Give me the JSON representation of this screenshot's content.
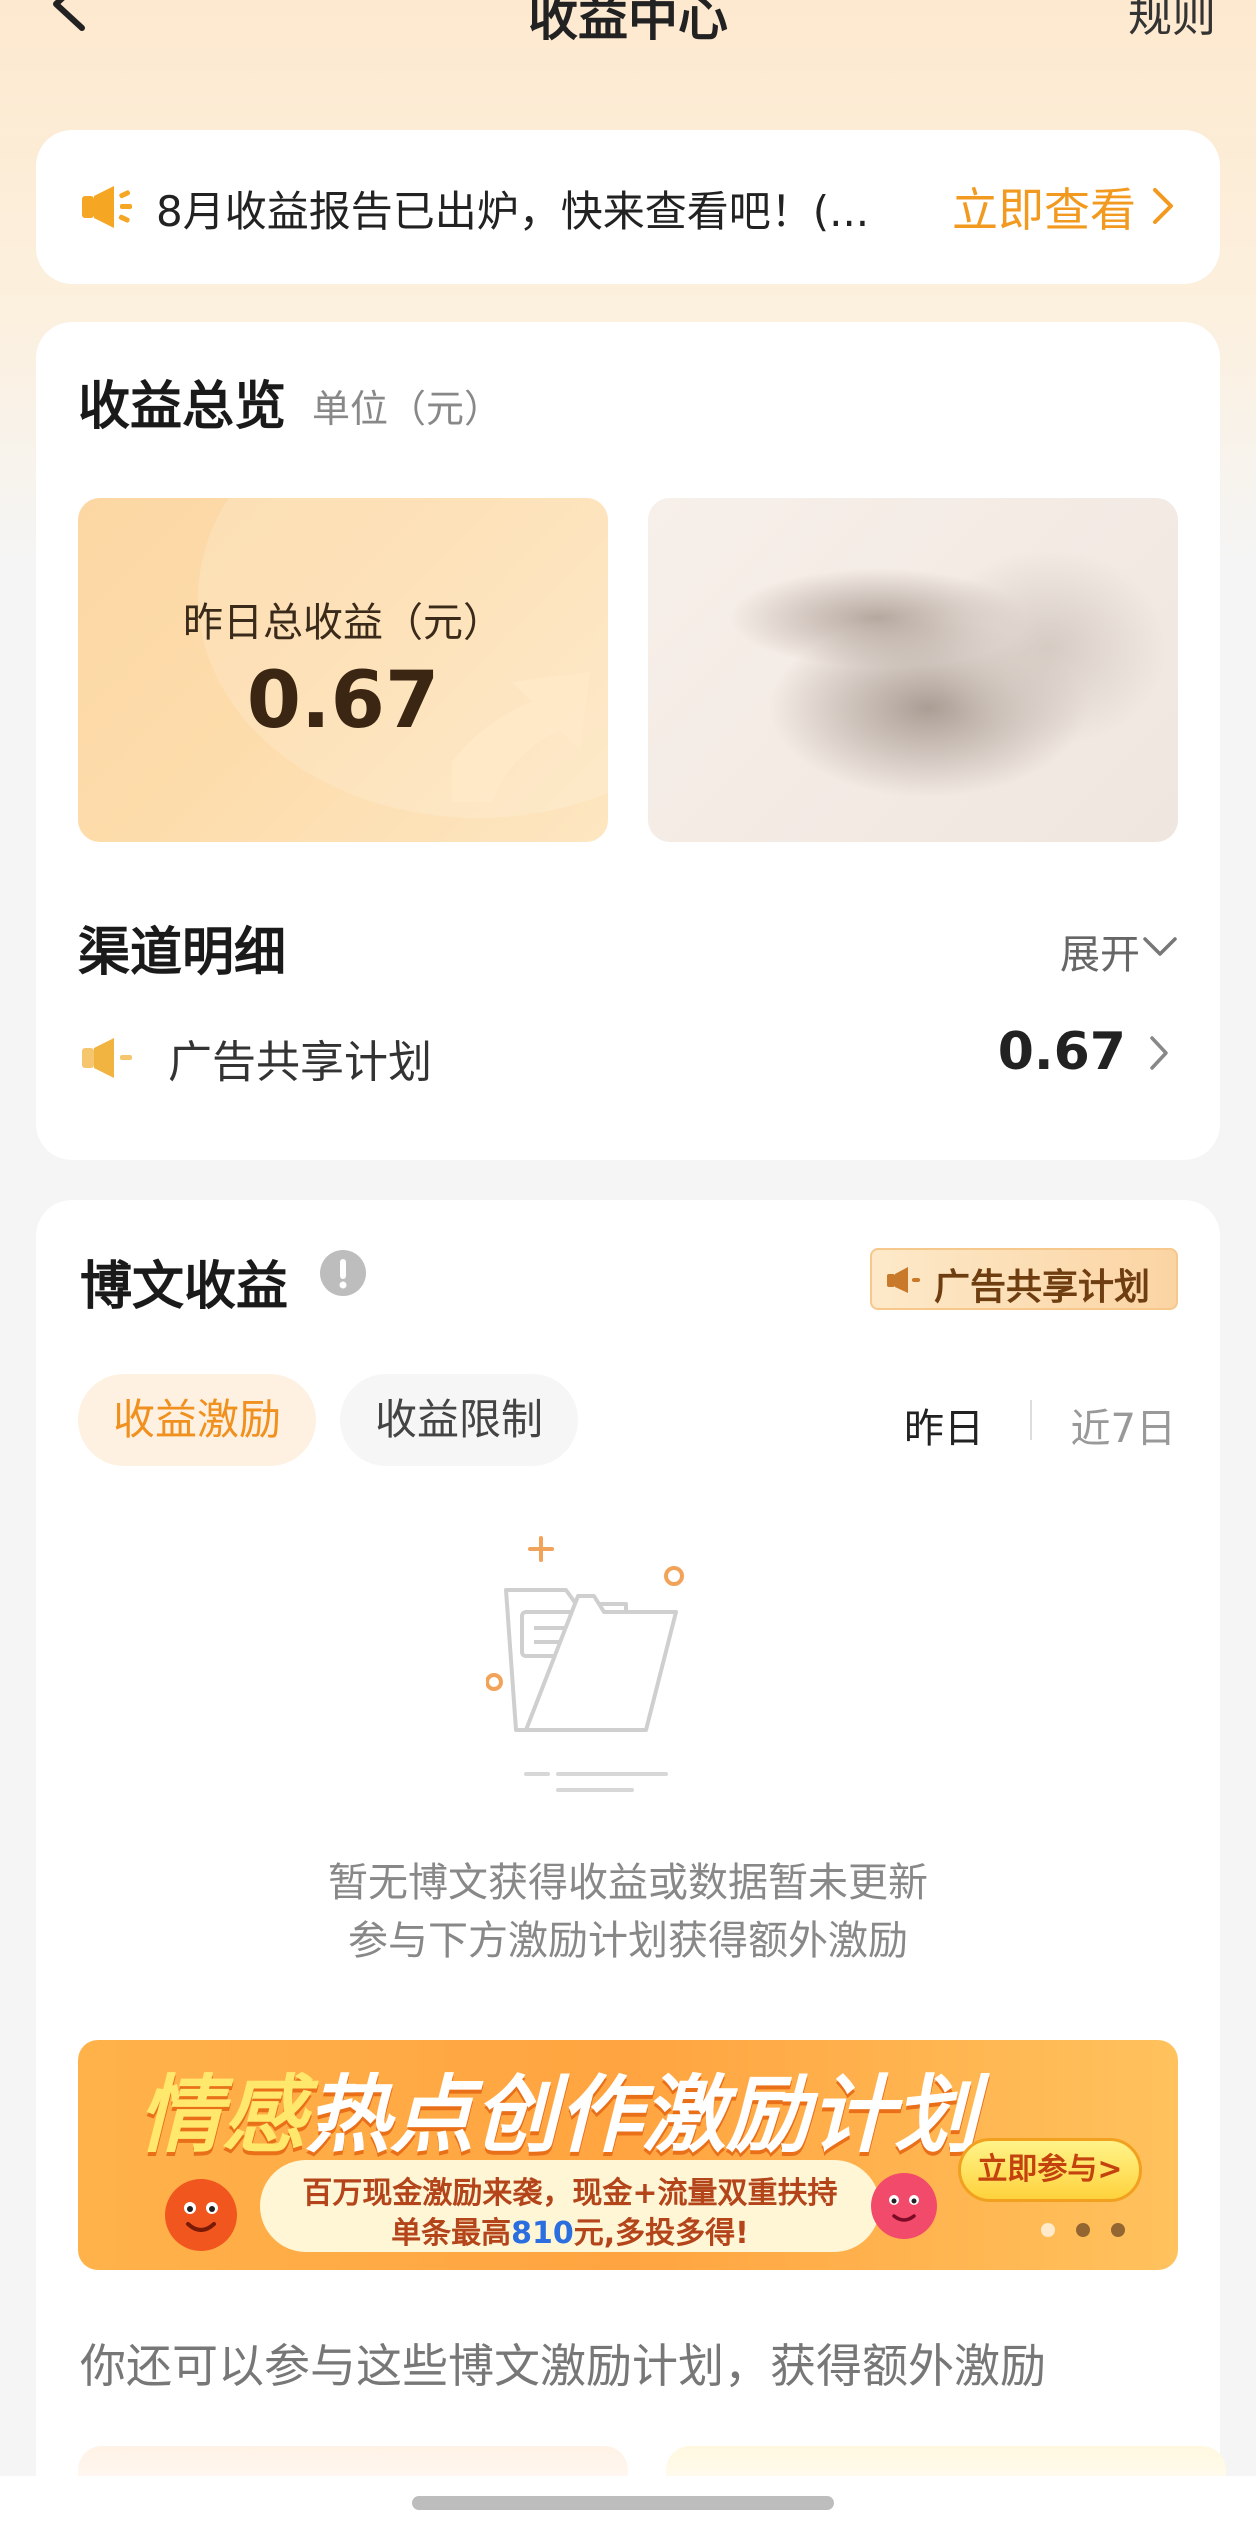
{
  "header": {
    "title": "收益中心",
    "rule_label": "规则"
  },
  "notice": {
    "text": "8月收益报告已出炉，快来查看吧！(...",
    "link_label": "立即查看"
  },
  "overview": {
    "title": "收益总览",
    "unit": "单位（元）",
    "yesterday_label": "昨日总收益（元）",
    "yesterday_value": "0.67"
  },
  "channel": {
    "title": "渠道明细",
    "expand_label": "展开",
    "items": [
      {
        "label": "广告共享计划",
        "value": "0.67"
      }
    ]
  },
  "blog": {
    "title": "博文收益",
    "badge_label": "广告共享计划",
    "tabs": [
      {
        "label": "收益激励",
        "active": true
      },
      {
        "label": "收益限制",
        "active": false
      }
    ],
    "ranges": [
      {
        "label": "昨日",
        "active": true
      },
      {
        "label": "近7日",
        "active": false
      }
    ],
    "empty_line1": "暂无博文获得收益或数据暂未更新",
    "empty_line2": "参与下方激励计划获得额外激励",
    "banner": {
      "title_part1": "情感",
      "title_part2": "热点创作激励计划",
      "line1": "百万现金激励来袭，现金+流量双重扶持",
      "line2_prefix": "单条最高",
      "line2_number": "810",
      "line2_suffix": "元,多投多得!",
      "cta": "立即参与>",
      "slide_count": 3,
      "active_slide": 2
    },
    "more_hint": "你还可以参与这些博文激励计划，获得额外激励"
  },
  "colors": {
    "accent": "#f29a1f",
    "page_bg": "#f5f5f5",
    "header_gradient_top": "#fde9cf"
  }
}
